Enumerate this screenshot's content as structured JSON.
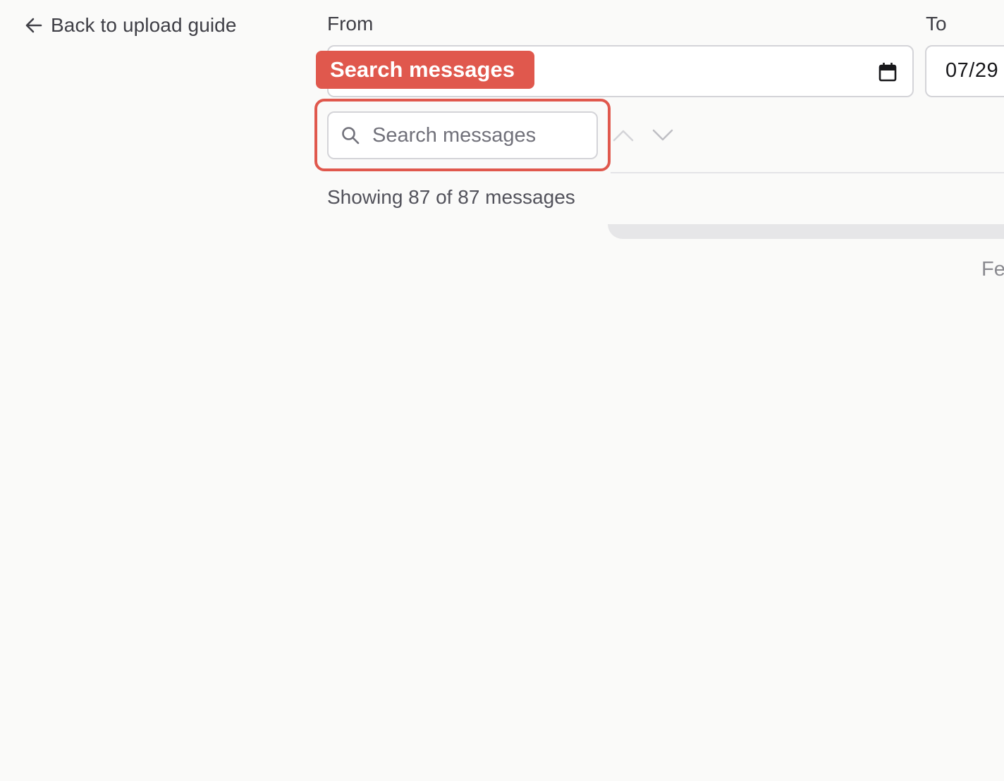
{
  "back_link": {
    "label": "Back to upload guide",
    "icon": "arrow-left-icon"
  },
  "filters": {
    "from_label": "From",
    "from_value": "",
    "to_label": "To",
    "to_value": "07/29",
    "calendar_icon": "calendar-icon"
  },
  "highlight": {
    "tag_label": "Search messages",
    "color": "#e0584d"
  },
  "search": {
    "placeholder": "Search messages",
    "value": "",
    "icon": "search-icon",
    "prev_icon": "chevron-up-icon",
    "next_icon": "chevron-down-icon"
  },
  "results": {
    "count_text": "Showing 87 of 87 messages"
  },
  "timeline": {
    "month_label": "Fe"
  }
}
